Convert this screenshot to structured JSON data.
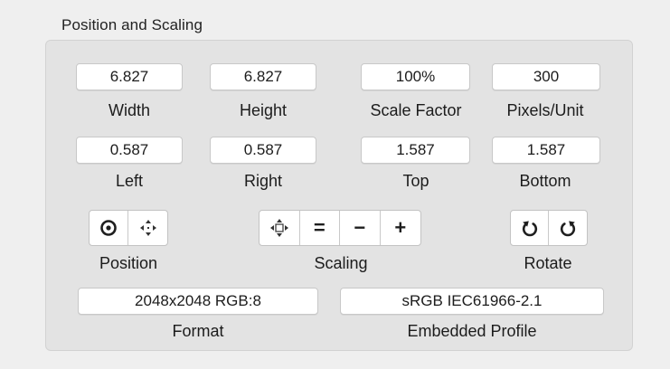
{
  "section": {
    "title": "Position and Scaling"
  },
  "size": {
    "width": {
      "value": "6.827",
      "label": "Width"
    },
    "height": {
      "value": "6.827",
      "label": "Height"
    },
    "scale_factor": {
      "value": "100%",
      "label": "Scale Factor"
    },
    "pixels_per_unit": {
      "value": "300",
      "label": "Pixels/Unit"
    }
  },
  "margins": {
    "left": {
      "value": "0.587",
      "label": "Left"
    },
    "right": {
      "value": "0.587",
      "label": "Right"
    },
    "top": {
      "value": "1.587",
      "label": "Top"
    },
    "bottom": {
      "value": "1.587",
      "label": "Bottom"
    }
  },
  "controls": {
    "position": {
      "label": "Position",
      "buttons": [
        "center-position-icon",
        "move-arrows-icon"
      ]
    },
    "scaling": {
      "label": "Scaling",
      "buttons": [
        "scale-to-fit-icon",
        "equals-icon",
        "minus-icon",
        "plus-icon"
      ],
      "equals_glyph": "=",
      "minus_glyph": "−",
      "plus_glyph": "+"
    },
    "rotate": {
      "label": "Rotate",
      "buttons": [
        "rotate-left-icon",
        "rotate-right-icon"
      ]
    }
  },
  "info": {
    "format": {
      "value": "2048x2048 RGB:8",
      "label": "Format"
    },
    "profile": {
      "value": "sRGB IEC61966-2.1",
      "label": "Embedded Profile"
    }
  }
}
